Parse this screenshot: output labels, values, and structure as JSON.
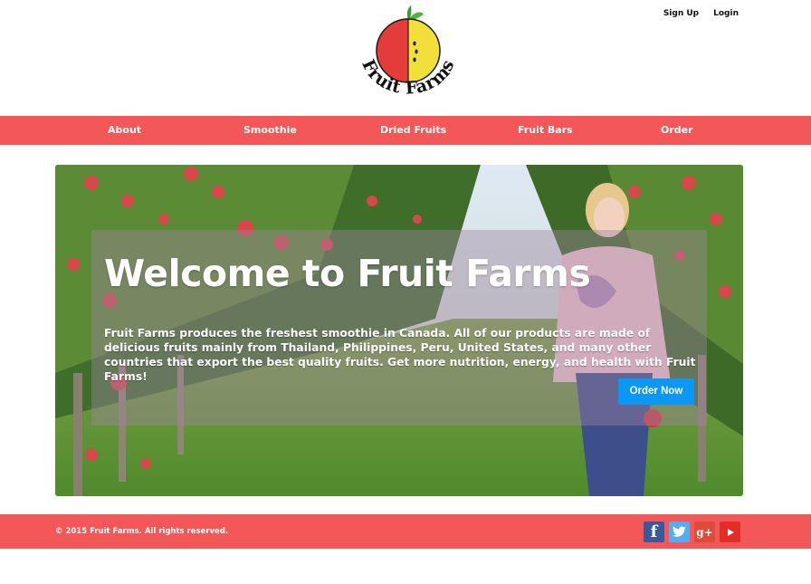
{
  "header": {
    "brand": "Fruit Farms",
    "sign_up": "Sign Up",
    "login": "Login"
  },
  "nav": {
    "items": [
      {
        "label": "About"
      },
      {
        "label": "Smoothie"
      },
      {
        "label": "Dried Fruits"
      },
      {
        "label": "Fruit Bars"
      },
      {
        "label": "Order"
      }
    ]
  },
  "hero": {
    "title": "Welcome to Fruit Farms",
    "text": "Fruit Farms produces the freshest smoothie in Canada. All of our products are made of delicious fruits mainly from Thailand, Philippines, Peru, United States, and many other countries that export the best quality fruits. Get more nutrition, energy, and health with Fruit Farms!",
    "button": "Order Now"
  },
  "footer": {
    "copyright": "© 2015 Fruit Farms. All rights reserved.",
    "social": [
      "facebook-icon",
      "twitter-icon",
      "google-plus-icon",
      "youtube-icon"
    ]
  },
  "colors": {
    "brand_red": "#f45757",
    "button_blue": "#0a97f5",
    "facebook": "#3b5998",
    "twitter": "#55acee",
    "google_plus": "#dd4b39",
    "youtube": "#e52d27"
  }
}
